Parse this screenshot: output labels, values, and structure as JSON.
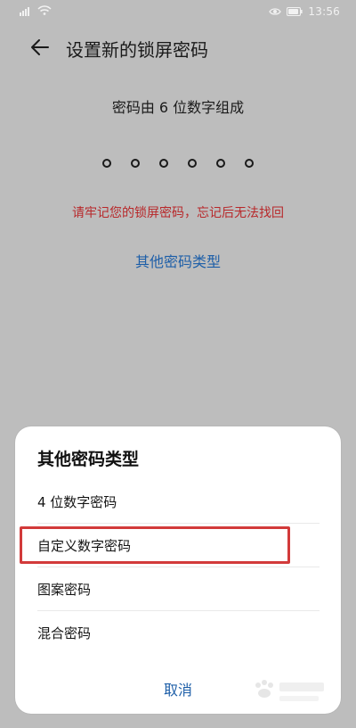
{
  "status_bar": {
    "time": "13:56",
    "icons": [
      "signal-icon",
      "wifi-icon",
      "eye-comfort-icon",
      "battery-icon"
    ]
  },
  "header": {
    "title": "设置新的锁屏密码",
    "back_icon": "back-arrow-icon"
  },
  "main": {
    "password_hint": "密码由 6 位数字组成",
    "digits": 6,
    "warning": "请牢记您的锁屏密码，忘记后无法找回",
    "other_types_link": "其他密码类型"
  },
  "sheet": {
    "title": "其他密码类型",
    "options": [
      {
        "label": "4 位数字密码"
      },
      {
        "label": "自定义数字密码"
      },
      {
        "label": "图案密码"
      },
      {
        "label": "混合密码"
      }
    ],
    "cancel": "取消"
  },
  "colors": {
    "overlay_bg": "#bdbdbd",
    "warning_red": "#b8282a",
    "link_blue": "#1e5fa8",
    "highlight_red": "#d23a3a"
  }
}
